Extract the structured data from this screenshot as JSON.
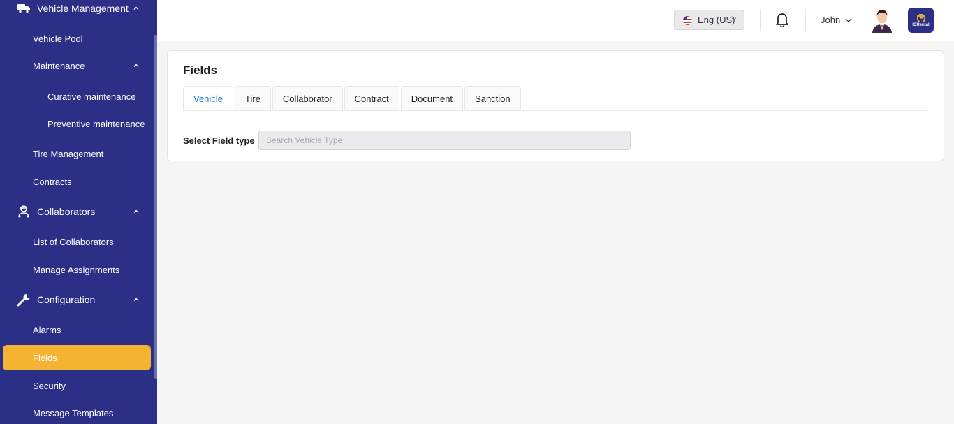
{
  "sidebar": {
    "sections": {
      "vehicle_management": "Vehicle Management",
      "collaborators": "Collaborators",
      "configuration": "Configuration"
    },
    "items": {
      "vehicle_pool": "Vehicle Pool",
      "maintenance": "Maintenance",
      "curative_maintenance": "Curative maintenance",
      "preventive_maintenance": "Preventive maintenance",
      "tire_management": "Tire Management",
      "contracts": "Contracts",
      "list_of_collaborators": "List of Collaborators",
      "manage_assignments": "Manage Assignments",
      "alarms": "Alarms",
      "fields": "Fields",
      "security": "Security",
      "message_templates": "Message Templates"
    },
    "active_item": "Fields"
  },
  "header": {
    "language": "Eng (US)",
    "user_name": "John",
    "logo_text": "IDRental"
  },
  "main": {
    "title": "Fields",
    "tabs": [
      "Vehicle",
      "Tire",
      "Collaborator",
      "Contract",
      "Document",
      "Sanction"
    ],
    "active_tab": "Vehicle",
    "field_label": "Select Field type",
    "field_placeholder": "Search Vehicle Type"
  },
  "colors": {
    "sidebar_bg": "#2c2f86",
    "active_item_bg": "#f5b333",
    "active_tab_text": "#1677d2",
    "page_bg": "#f5f5f5"
  }
}
